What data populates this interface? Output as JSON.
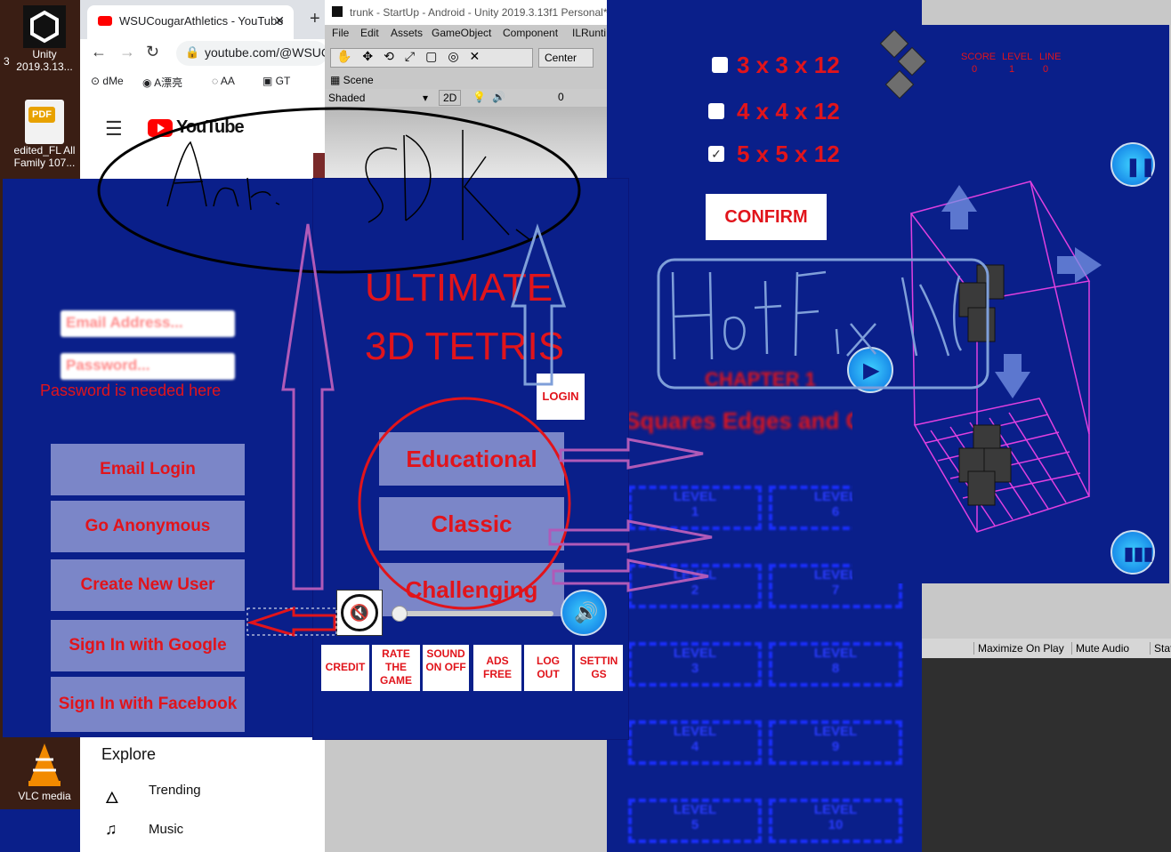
{
  "desktop": {
    "icons": [
      {
        "label": "Unity 2019.3.13...",
        "icon": "unity-icon"
      },
      {
        "label": "edited_FL All Family 107...",
        "icon": "pdf-icon"
      },
      {
        "label": "VLC media",
        "icon": "vlc-icon"
      }
    ],
    "stray": "3"
  },
  "chrome": {
    "tab_title": "WSUCougarAthletics - YouTube",
    "url": "youtube.com/@WSUC",
    "bookmarks": [
      "dMe",
      "A漂亮",
      "AA",
      "GT"
    ],
    "logo": "YouTube",
    "explore": "Explore",
    "nav": [
      "Trending",
      "Music"
    ]
  },
  "unity": {
    "title": "trunk - StartUp - Android - Unity 2019.3.13f1 Personal*",
    "menu": [
      "File",
      "Edit",
      "Assets",
      "GameObject",
      "Component",
      "ILRunti"
    ],
    "center": "Center",
    "scene_tab": "Scene",
    "shaded": "Shaded",
    "mode2d": "2D",
    "fx_count": "0",
    "bottom_bar": [
      "Maximize On Play",
      "Mute Audio",
      "Stats"
    ]
  },
  "login": {
    "email_placeholder": "Email Address...",
    "password_placeholder": "Password...",
    "error": "Password is needed here",
    "buttons": [
      "Email Login",
      "Go Anonymous",
      "Create New User",
      "Sign In with Google",
      "Sign In with Facebook"
    ]
  },
  "main_menu": {
    "title_line1": "ULTIMATE",
    "title_line2": "3D TETRIS",
    "login_label": "LOGIN",
    "modes": [
      "Educational",
      "Classic",
      "Challenging"
    ],
    "small_buttons": [
      "CREDIT",
      "RATE THE GAME",
      "SOUND ON OFF",
      "ADS FREE",
      "LOG OUT",
      "SETTIN GS"
    ],
    "volume_level": 0.0
  },
  "options": {
    "sizes": [
      {
        "label": "3 x 3 x 12",
        "checked": false
      },
      {
        "label": "4 x 4 x 12",
        "checked": false
      },
      {
        "label": "5 x 5 x 12",
        "checked": true
      }
    ],
    "confirm": "CONFIRM"
  },
  "levels": {
    "chapter": "CHAPTER 1",
    "subtitle": "Squares Edges and Corners",
    "items": [
      "LEVEL 1",
      "LEVEL 6",
      "LEVEL 2",
      "LEVEL 7",
      "LEVEL 3",
      "LEVEL 8",
      "LEVEL 4",
      "LEVEL 9",
      "LEVEL 5",
      "LEVEL 10"
    ]
  },
  "game": {
    "score_label": "SCORE",
    "level_label": "LEVEL",
    "line_label": "LINE",
    "score": "0",
    "level": "1",
    "line": "0"
  },
  "annotations": {
    "scribble_left": "Ant...",
    "scribble_right": "SDK",
    "hotfix": "HotFix XLua"
  },
  "colors": {
    "game_blue": "#0a1f8a",
    "accent_red": "#e1141b",
    "button_lavender": "#7b86c8",
    "arrow_purple": "#b05ab8"
  }
}
